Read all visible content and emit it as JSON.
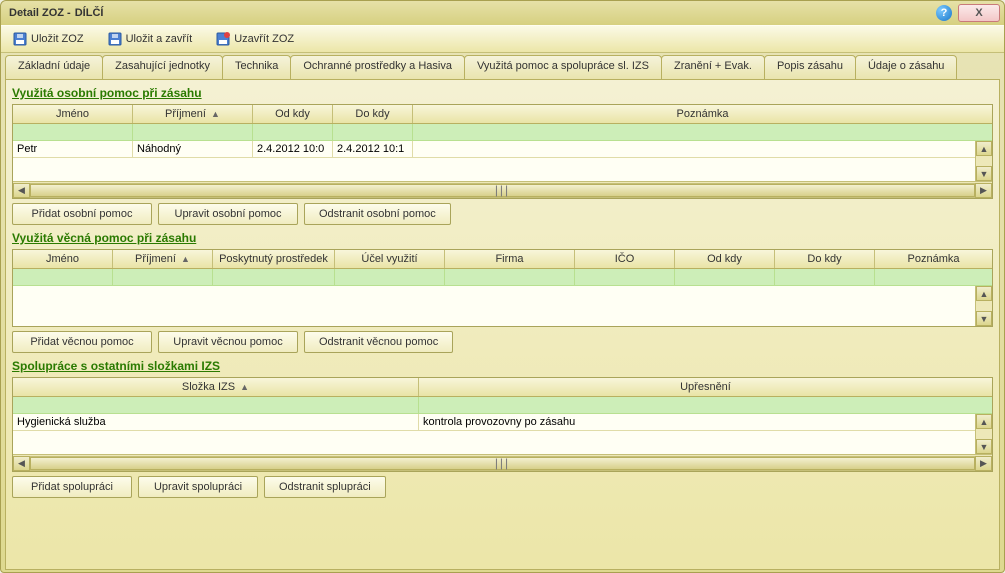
{
  "window": {
    "title_a": "Detail ZOZ -",
    "title_b": "DÍLČÍ",
    "close": "X"
  },
  "toolbar": {
    "save": "Uložit ZOZ",
    "save_close": "Uložit a zavřít",
    "close_zoz": "Uzavřít ZOZ"
  },
  "tabs": {
    "t1": "Základní údaje",
    "t2": "Zasahující jednotky",
    "t3": "Technika",
    "t4": "Ochranné prostředky a Hasiva",
    "t5": "Využitá pomoc a spolupráce sl. IZS",
    "t6": "Zranění + Evak.",
    "t7": "Popis zásahu",
    "t8": "Údaje o zásahu"
  },
  "section1": {
    "title": "Využitá osobní pomoc při zásahu",
    "headers": {
      "h1": "Jméno",
      "h2": "Příjmení",
      "sort": "▲",
      "h3": "Od kdy",
      "h4": "Do kdy",
      "h5": "Poznámka"
    },
    "rows": [
      {
        "c1": "Petr",
        "c2": "Náhodný",
        "c3": "2.4.2012 10:0",
        "c4": "2.4.2012 10:1",
        "c5": ""
      }
    ],
    "btns": {
      "add": "Přidat osobní pomoc",
      "edit": "Upravit osobní pomoc",
      "del": "Odstranit osobní pomoc"
    }
  },
  "section2": {
    "title": "Využitá věcná pomoc při zásahu",
    "headers": {
      "h1": "Jméno",
      "h2": "Příjmení",
      "sort": "▲",
      "h3": "Poskytnutý prostředek",
      "h4": "Účel využití",
      "h5": "Firma",
      "h6": "IČO",
      "h7": "Od kdy",
      "h8": "Do kdy",
      "h9": "Poznámka"
    },
    "btns": {
      "add": "Přidat věcnou pomoc",
      "edit": "Upravit věcnou pomoc",
      "del": "Odstranit věcnou pomoc"
    }
  },
  "section3": {
    "title": "Spolupráce s ostatními složkami IZS",
    "headers": {
      "h1": "Složka IZS",
      "sort": "▲",
      "h2": "Upřesnění"
    },
    "rows": [
      {
        "c1": "Hygienická služba",
        "c2": "kontrola provozovny po zásahu"
      }
    ],
    "btns": {
      "add": "Přidat spolupráci",
      "edit": "Upravit spolupráci",
      "del": "Odstranit splupráci"
    }
  },
  "scroll_grip": "|||"
}
